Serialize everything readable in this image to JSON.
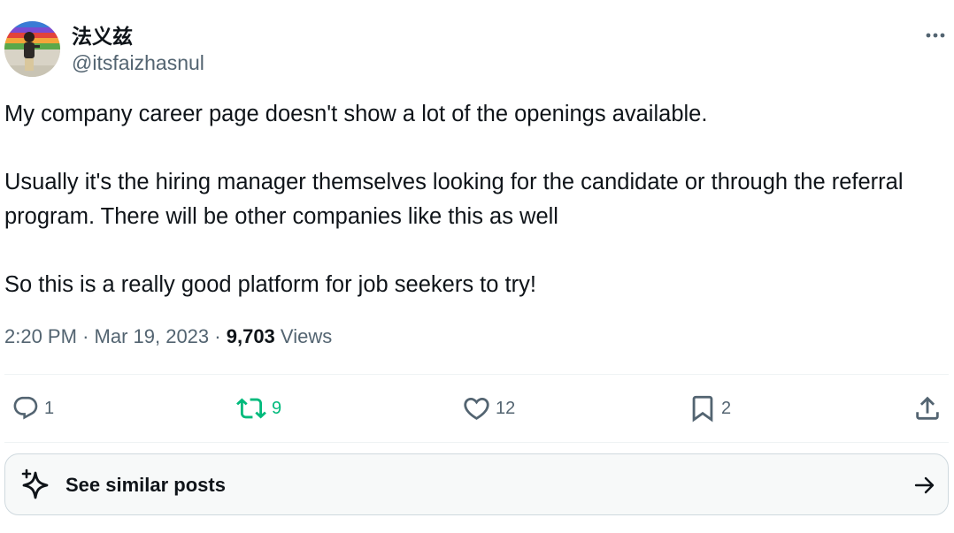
{
  "author": {
    "display_name": "法义兹",
    "handle": "@itsfaizhasnul"
  },
  "tweet": {
    "paragraphs": [
      "My company career page doesn't show a lot of the openings available.",
      "Usually it's the hiring manager themselves looking for the candidate or through the referral program. There will be other companies like this as well",
      "So this is a really good platform for job seekers to try!"
    ],
    "time": "2:20 PM",
    "separator": "·",
    "date": "Mar 19, 2023",
    "views_count": "9,703",
    "views_label": "Views"
  },
  "actions": {
    "reply_count": "1",
    "retweet_count": "9",
    "like_count": "12",
    "bookmark_count": "2"
  },
  "similar": {
    "label": "See similar posts"
  },
  "icons": {
    "more": "more-horizontal-icon",
    "reply": "reply-icon",
    "retweet": "retweet-icon",
    "like": "heart-icon",
    "bookmark": "bookmark-icon",
    "share": "share-icon",
    "sparkle": "sparkle-icon",
    "arrow": "arrow-right-icon"
  },
  "colors": {
    "text": "#0f1419",
    "secondary": "#536471",
    "retweet_green": "#00ba7c",
    "border": "#cfd9de",
    "divider": "#eff3f4",
    "card_bg": "#f7f9f9"
  }
}
